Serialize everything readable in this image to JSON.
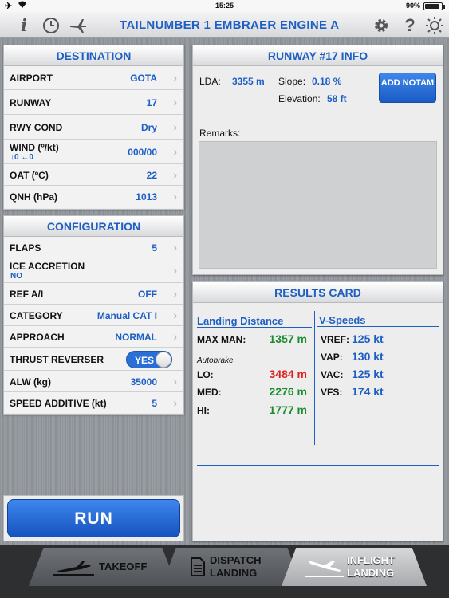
{
  "status_bar": {
    "time": "15:25",
    "battery": "90%",
    "battery_level": 0.9
  },
  "header": {
    "title": "TAILNUMBER 1   EMBRAER   ENGINE A"
  },
  "icons": {
    "info": "i",
    "help": "?"
  },
  "destination": {
    "title": "DESTINATION",
    "rows": [
      {
        "label": "AIRPORT",
        "value": "GOTA"
      },
      {
        "label": "RUNWAY",
        "value": "17"
      },
      {
        "label": "RWY COND",
        "value": "Dry"
      },
      {
        "label": "WIND (º/kt)",
        "value": "000/00",
        "sub": "↓0  ←0"
      },
      {
        "label": "OAT (ºC)",
        "value": "22"
      },
      {
        "label": "QNH (hPa)",
        "value": "1013"
      }
    ]
  },
  "configuration": {
    "title": "CONFIGURATION",
    "rows": [
      {
        "label": "FLAPS",
        "value": "5"
      },
      {
        "label": "ICE ACCRETION",
        "value": "",
        "sub": "NO"
      },
      {
        "label": "REF A/I",
        "value": "OFF"
      },
      {
        "label": "CATEGORY",
        "value": "Manual CAT I"
      },
      {
        "label": "APPROACH",
        "value": "NORMAL"
      },
      {
        "label": "THRUST REVERSER",
        "toggle": "YES"
      },
      {
        "label": "ALW (kg)",
        "value": "35000"
      },
      {
        "label": "SPEED ADDITIVE (kt)",
        "value": "5"
      }
    ]
  },
  "runway_info": {
    "title": "RUNWAY #17 INFO",
    "lda_label": "LDA:",
    "lda_value": "3355 m",
    "slope_label": "Slope:",
    "slope_value": "0.18 %",
    "elevation_label": "Elevation:",
    "elevation_value": "58 ft",
    "notam_button": "ADD NOTAM",
    "remarks_label": "Remarks:"
  },
  "results": {
    "title": "RESULTS CARD",
    "landing_distance_header": "Landing Distance",
    "vspeeds_header": "V-Speeds",
    "max_man_label": "MAX MAN:",
    "max_man_value": "1357 m",
    "autobrake_label": "Autobrake",
    "lo_label": "LO:",
    "lo_value": "3484 m",
    "med_label": "MED:",
    "med_value": "2276 m",
    "hi_label": "HI:",
    "hi_value": "1777 m",
    "vref_label": "VREF:",
    "vref_value": "125 kt",
    "vap_label": "VAP:",
    "vap_value": "130 kt",
    "vac_label": "VAC:",
    "vac_value": "125 kt",
    "vfs_label": "VFS:",
    "vfs_value": "174 kt"
  },
  "run_button": "RUN",
  "tabs": [
    {
      "label": "TAKEOFF"
    },
    {
      "label1": "DISPATCH",
      "label2": "LANDING"
    },
    {
      "label1": "INFLIGHT",
      "label2": "LANDING"
    }
  ],
  "colors": {
    "accent": "#1e5fc4",
    "green": "#1a8c2e",
    "red": "#e01d1d"
  }
}
